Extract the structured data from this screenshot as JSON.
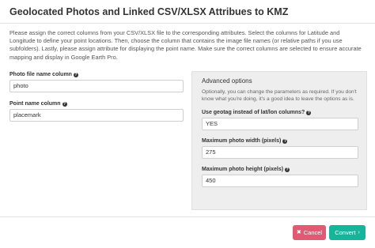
{
  "dialog": {
    "title": "Geolocated Photos and Linked CSV/XLSX Attribues to KMZ",
    "intro": "Please assign the correct columns from your CSV/XLSX file to the corresponding attributes. Select the columns for Latitude and Longitude to define your point locations. Then, choose the column that contains the image file names (or relative paths if you use subfolders). Lastly, please assign attribute for displaying the point name. Make sure the correct columns are selected to ensure accurate mapping and display in Google Earth Pro."
  },
  "fields": {
    "photo_label": "Photo file name column",
    "photo_value": "photo",
    "point_label": "Point name column",
    "point_value": "placemark"
  },
  "advanced": {
    "title": "Advanced options",
    "description": "Optionally, you can change the parameters as required. If you don't know what you're doing, it's a good idea to leave the options as is.",
    "geotag_label": "Use geotag instead of lat/lon columns?",
    "geotag_value": "YES",
    "width_label": "Maximum photo width (pixels)",
    "width_value": "275",
    "height_label": "Maximum photo height (pixels)",
    "height_value": "450"
  },
  "footer": {
    "cancel_label": "Cancel",
    "convert_label": "Convert",
    "cancel_icon": "x-square-icon",
    "convert_icon": "chevron-right-icon"
  },
  "colors": {
    "cancel": "#e05a74",
    "convert": "#16b49b",
    "advanced_bg": "#eeeeee"
  },
  "help_icon_glyph": "?"
}
